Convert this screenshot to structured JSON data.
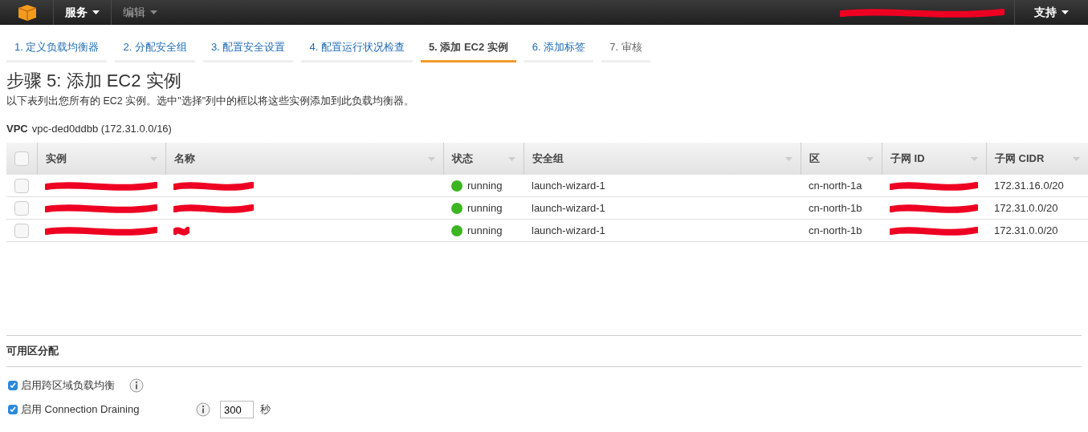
{
  "top_bar": {
    "menus": [
      {
        "label": "服务",
        "bold": true
      },
      {
        "label": "编辑",
        "bold": false
      }
    ],
    "account": {
      "redacted": true
    },
    "support": "支持"
  },
  "tabs": [
    {
      "label": "1. 定义负载均衡器",
      "selected": false,
      "visited": true
    },
    {
      "label": "2. 分配安全组",
      "selected": false,
      "visited": true
    },
    {
      "label": "3. 配置安全设置",
      "selected": false,
      "visited": true
    },
    {
      "label": "4. 配置运行状况检查",
      "selected": false,
      "visited": true
    },
    {
      "label": "5. 添加 EC2 实例",
      "selected": true,
      "visited": true
    },
    {
      "label": "6. 添加标签",
      "selected": false,
      "visited": true
    },
    {
      "label": "7. 审核",
      "selected": false,
      "visited": false
    }
  ],
  "heading": "步骤 5: 添加 EC2 实例",
  "description": "以下表列出您所有的 EC2 实例。选中\"选择\"列中的框以将这些实例添加到此负载均衡器。",
  "vpc": {
    "label": "VPC",
    "value": "vpc-ded0ddbb (172.31.0.0/16)"
  },
  "table": {
    "select_all": {
      "checked": false
    },
    "columns": [
      "实例",
      "名称",
      "状态",
      "安全组",
      "区",
      "子网 ID",
      "子网 CIDR"
    ],
    "rows": [
      {
        "checked": false,
        "instance": {
          "redacted": true
        },
        "name": {
          "redacted": true
        },
        "state": "running",
        "color": "#3cb521",
        "security_group": "launch-wizard-1",
        "zone": "cn-north-1a",
        "subnet_id": {
          "redacted": true
        },
        "subnet_cidr": "172.31.16.0/20"
      },
      {
        "checked": false,
        "instance": {
          "redacted": true
        },
        "name": {
          "redacted": true
        },
        "state": "running",
        "color": "#3cb521",
        "security_group": "launch-wizard-1",
        "zone": "cn-north-1b",
        "subnet_id": {
          "redacted": true
        },
        "subnet_cidr": "172.31.0.0/20"
      },
      {
        "checked": false,
        "instance": {
          "redacted": true
        },
        "name": {
          "redacted": true,
          "short": true
        },
        "state": "running",
        "color": "#3cb521",
        "security_group": "launch-wizard-1",
        "zone": "cn-north-1b",
        "subnet_id": {
          "redacted": true
        },
        "subnet_cidr": "172.31.0.0/20"
      }
    ]
  },
  "availability": {
    "title": "可用区分配",
    "options": [
      {
        "kind": "checkbox",
        "label": "启用跨区域负载均衡",
        "checked": true
      },
      {
        "kind": "timeout",
        "label": "启用 Connection Draining",
        "checked": true,
        "value": "300",
        "unit": "秒"
      }
    ]
  }
}
